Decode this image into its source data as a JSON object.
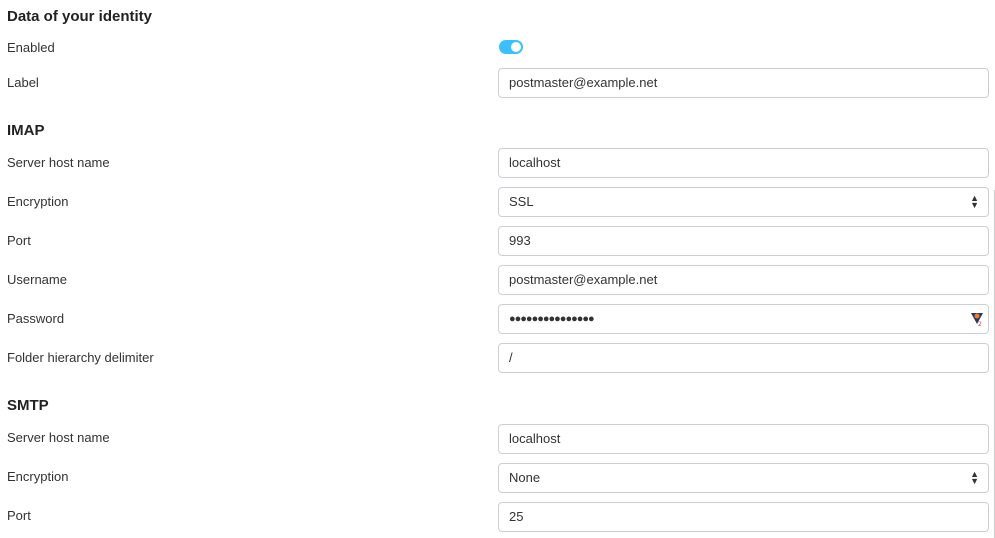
{
  "identity": {
    "heading": "Data of your identity",
    "enabled_label": "Enabled",
    "enabled": true,
    "label_label": "Label",
    "label_value": "postmaster@example.net"
  },
  "imap": {
    "heading": "IMAP",
    "host_label": "Server host name",
    "host": "localhost",
    "enc_label": "Encryption",
    "enc": "SSL",
    "port_label": "Port",
    "port": "993",
    "user_label": "Username",
    "user": "postmaster@example.net",
    "pass_label": "Password",
    "pass": "●●●●●●●●●●●●●●●",
    "delim_label": "Folder hierarchy delimiter",
    "delim": "/"
  },
  "smtp": {
    "heading": "SMTP",
    "host_label": "Server host name",
    "host": "localhost",
    "enc_label": "Encryption",
    "enc": "None",
    "port_label": "Port",
    "port": "25"
  },
  "colors": {
    "toggle_on": "#3cbfff",
    "input_border": "#ccd0d5"
  }
}
